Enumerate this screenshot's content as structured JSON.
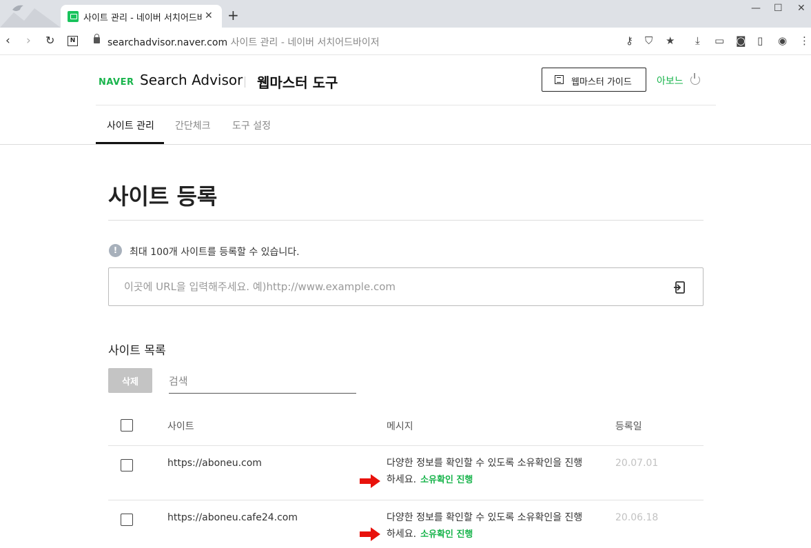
{
  "browser": {
    "tab_title": "사이트 관리 - 네이버 서치어드바이저",
    "tab_close": "✕",
    "new_tab": "+",
    "url_host": "searchadvisor.naver.com",
    "url_title": "사이트 관리 - 네이버 서치어드바이저",
    "url_separator": "  "
  },
  "header": {
    "logo": "NAVER",
    "brand": "Search Advisor",
    "tool_title": "웹마스터 도구",
    "guide_button": "웹마스터 가이드",
    "user_name": "아보느"
  },
  "nav": {
    "tabs": [
      "사이트 관리",
      "간단체크",
      "도구 설정"
    ],
    "active_index": 0
  },
  "main": {
    "page_title": "사이트 등록",
    "info_icon_glyph": "!",
    "info_text": "최대 100개 사이트를 등록할 수 있습니다.",
    "url_placeholder": "이곳에 URL을 입력해주세요. 예)http://www.example.com",
    "list_title": "사이트 목록",
    "delete_button": "삭제",
    "search_placeholder": "검색"
  },
  "table": {
    "headers": {
      "site": "사이트",
      "message": "메시지",
      "date": "등록일"
    },
    "rows": [
      {
        "site": "https://aboneu.com",
        "message_line1": "다양한 정보를 확인할 수 있도록 소유확인을 진행",
        "message_line2": "하세요.",
        "verify_link": "소유확인 진행",
        "date": "20.07.01"
      },
      {
        "site": "https://aboneu.cafe24.com",
        "message_line1": "다양한 정보를 확인할 수 있도록 소유확인을 진행",
        "message_line2": "하세요.",
        "verify_link": "소유확인 진행",
        "date": "20.06.18"
      }
    ]
  },
  "colors": {
    "naver_green": "#19b44c",
    "arrow_red": "#e8120c",
    "disabled_button": "#c4c4c4"
  }
}
